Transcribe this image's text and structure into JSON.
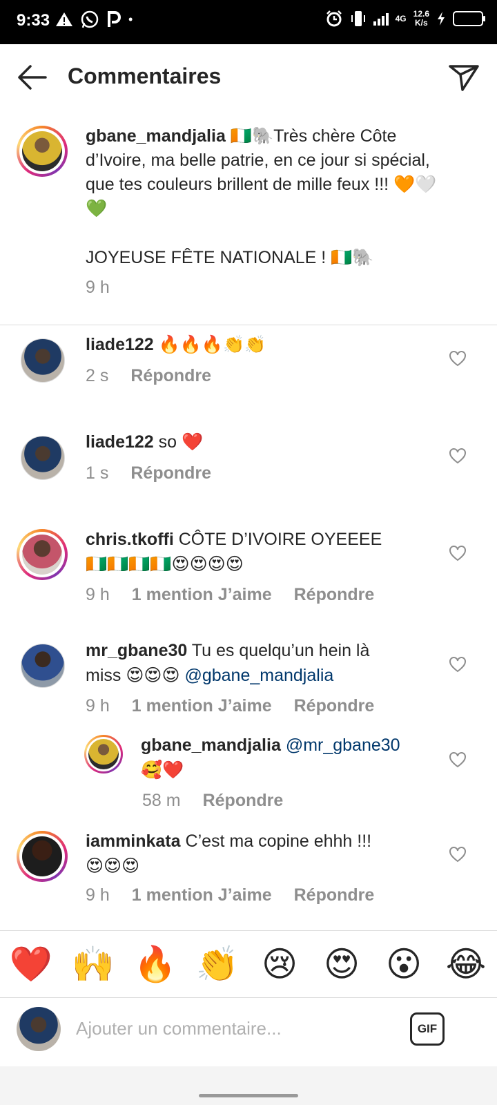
{
  "status_bar": {
    "time": "9:33",
    "left_icons": [
      "warning-icon",
      "whatsapp-icon",
      "parking-icon"
    ],
    "dot": "•",
    "net_type": "4G",
    "speed_value": "12.6",
    "speed_unit": "K/s"
  },
  "header": {
    "title": "Commentaires"
  },
  "caption": {
    "username": "gbane_mandjalia",
    "text": "🇨🇮🐘Très chère Côte d’Ivoire, ma belle patrie, en ce jour si spécial, que tes couleurs brillent de mille feux !!! 🧡🤍💚",
    "text2": "JOYEUSE FÊTE NATIONALE ! 🇨🇮🐘",
    "time": "9 h"
  },
  "comments": [
    {
      "username": "liade122",
      "text": "🔥🔥🔥👏👏",
      "time": "2 s",
      "reply": "Répondre"
    },
    {
      "username": "liade122",
      "text": "so ❤️",
      "time": "1 s",
      "reply": "Répondre"
    },
    {
      "username": "chris.tkoffi",
      "text": "CÔTE D’IVOIRE OYEEEE",
      "text2": "🇨🇮🇨🇮🇨🇮🇨🇮😍😍😍😍",
      "time": "9 h",
      "likes": "1 mention J’aime",
      "reply": "Répondre"
    },
    {
      "username": "mr_gbane30",
      "text": "Tu es quelqu’un hein là",
      "text2": "miss 😍😍😍",
      "mention": "@gbane_mandjalia",
      "time": "9 h",
      "likes": "1 mention J’aime",
      "reply": "Répondre"
    },
    {
      "username": "gbane_mandjalia",
      "mention": "@mr_gbane30",
      "text2": "🥰❤️",
      "time": "58 m",
      "reply": "Répondre"
    },
    {
      "username": "iamminkata",
      "text": "C’est ma copine ehhh !!!",
      "text2": "😍😍😍",
      "time": "9 h",
      "likes": "1 mention J’aime",
      "reply": "Répondre"
    }
  ],
  "reactions": [
    "❤️",
    "🙌",
    "🔥",
    "👏",
    "😢",
    "😍",
    "😮",
    "😂"
  ],
  "composer": {
    "placeholder": "Ajouter un commentaire...",
    "gif_label": "GIF"
  }
}
